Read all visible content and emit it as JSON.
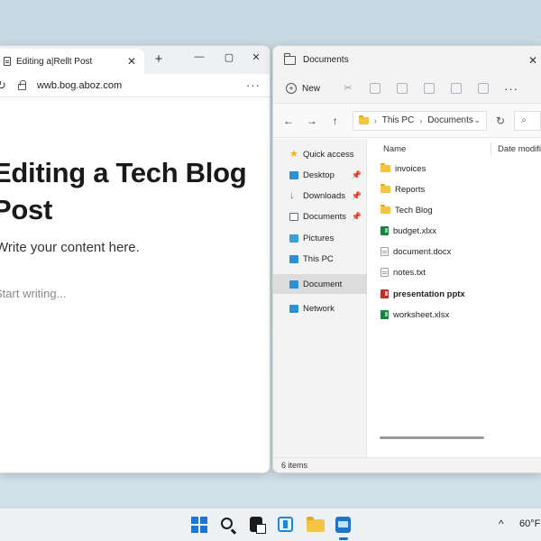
{
  "browser": {
    "tab_title": "Editing a|Rellt Post",
    "tab_close": "✕",
    "new_tab": "+",
    "minimize": "—",
    "maximize": "▢",
    "close": "✕",
    "url": "wwb.bog.aboz.com",
    "menu": "···",
    "page_title": "Editing a Tech Blog Post",
    "page_subtitle": "Write your content here.",
    "page_placeholder": "Start writing..."
  },
  "explorer": {
    "title": "Documents",
    "close": "✕",
    "toolbar": {
      "new_label": "New",
      "more": "···"
    },
    "breadcrumb": [
      "This PC",
      "Documents"
    ],
    "columns": {
      "name": "Name",
      "date_modified": "Date modified"
    },
    "sidebar": [
      {
        "label": "Quick access",
        "icon": "star-icon",
        "color": "#f2b30f",
        "pinned": false
      },
      {
        "label": "Desktop",
        "icon": "desktop-icon",
        "color": "#2d8fd6",
        "pinned": true
      },
      {
        "label": "Downloads",
        "icon": "download-icon",
        "color": "#2d7fc8",
        "pinned": true
      },
      {
        "label": "Documents",
        "icon": "documents-icon",
        "color": "#5b6f84",
        "pinned": true
      },
      {
        "label": "Pictures",
        "icon": "pictures-icon",
        "color": "#3aa0d8",
        "pinned": false
      },
      {
        "label": "This PC",
        "icon": "pc-icon",
        "color": "#2d8fd6",
        "pinned": false
      },
      {
        "label": "Document",
        "icon": "document-icon",
        "color": "#2d8fd6",
        "pinned": false,
        "active": true
      },
      {
        "label": "Network",
        "icon": "network-icon",
        "color": "#2d8fd6",
        "pinned": false
      }
    ],
    "files": [
      {
        "name": "invoices",
        "type": "folder"
      },
      {
        "name": "Reports",
        "type": "folder"
      },
      {
        "name": "Tech Blog",
        "type": "folder"
      },
      {
        "name": "budget.xlxx",
        "type": "xlsx"
      },
      {
        "name": "document.docx",
        "type": "doc"
      },
      {
        "name": "notes.txt",
        "type": "doc"
      },
      {
        "name": "presentation pptx",
        "type": "pptx"
      },
      {
        "name": "worksheet.xlsx",
        "type": "xlsx"
      }
    ],
    "status": "6 items"
  },
  "taskbar": {
    "tray_chevron": "^",
    "weather": "60°F"
  },
  "colors": {
    "accent": "#1877d4",
    "folder": "#f4c542",
    "excel": "#1e7e45",
    "powerpoint": "#b7322a"
  }
}
